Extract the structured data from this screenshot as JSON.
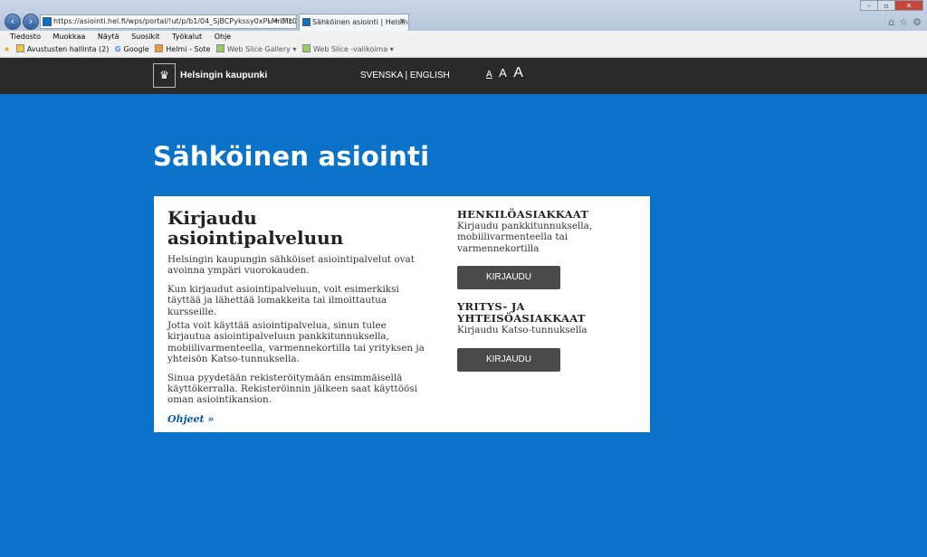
{
  "browser": {
    "url": "https://asiointi.hel.fi/wps/portal/!ut/p/b1/04_SjBCPykssy0xPLMnMz0vl",
    "tab_title": "Sähköinen asiointi | Helsing...",
    "tab_close": "×",
    "menu": [
      "Tiedosto",
      "Muokkaa",
      "Näytä",
      "Suosikit",
      "Työkalut",
      "Ohje"
    ],
    "favorites": {
      "item1": "Avustusten hallinta (2)",
      "item2": "Google",
      "item3": "Helmi - Sote",
      "item4": "Web Slice Gallery ▾",
      "item5": "Web Slice -valikoima ▾"
    }
  },
  "site": {
    "brand": "Helsingin kaupunki",
    "languages": "SVENSKA | ENGLISH",
    "font_sizes": [
      "A",
      "A",
      "A"
    ],
    "page_title": "Sähköinen asiointi"
  },
  "login": {
    "heading": "Kirjaudu asiointipalveluun",
    "para1": "Helsingin kaupungin sähköiset asiointipalvelut ovat avoinna ympäri vuorokauden.",
    "para2": "Kun kirjaudut asiointipalveluun, voit esimerkiksi täyttää ja lähettää lomakkeita tai ilmoittautua kursseille.",
    "para3": "Jotta voit käyttää asiointipalvelua, sinun tulee kirjautua asiointipalveluun pankkitunnuksella, mobiilivarmenteella, varmennekortilla tai yrityksen ja yhteisön Katso-tunnuksella.",
    "para4": "Sinua pyydetään rekisteröitymään ensimmäisellä käyttökerralla. Rekisteröinnin jälkeen saat käyttöösi oman asiointikansion.",
    "help_link": "Ohjeet »"
  },
  "personal": {
    "heading": "HENKILÖASIAKKAAT",
    "text": "Kirjaudu pankkitunnuksella, mobiilivarmenteella tai varmennekortilla",
    "button": "KIRJAUDU"
  },
  "business": {
    "heading": "YRITYS- JA YHTEISÖASIAKKAAT",
    "text": "Kirjaudu Katso-tunnuksella",
    "button": "KIRJAUDU"
  },
  "colors": {
    "page_bg": "#0a72c9",
    "header_bg": "#2a2a2a",
    "button_bg": "#4a4a4a"
  }
}
